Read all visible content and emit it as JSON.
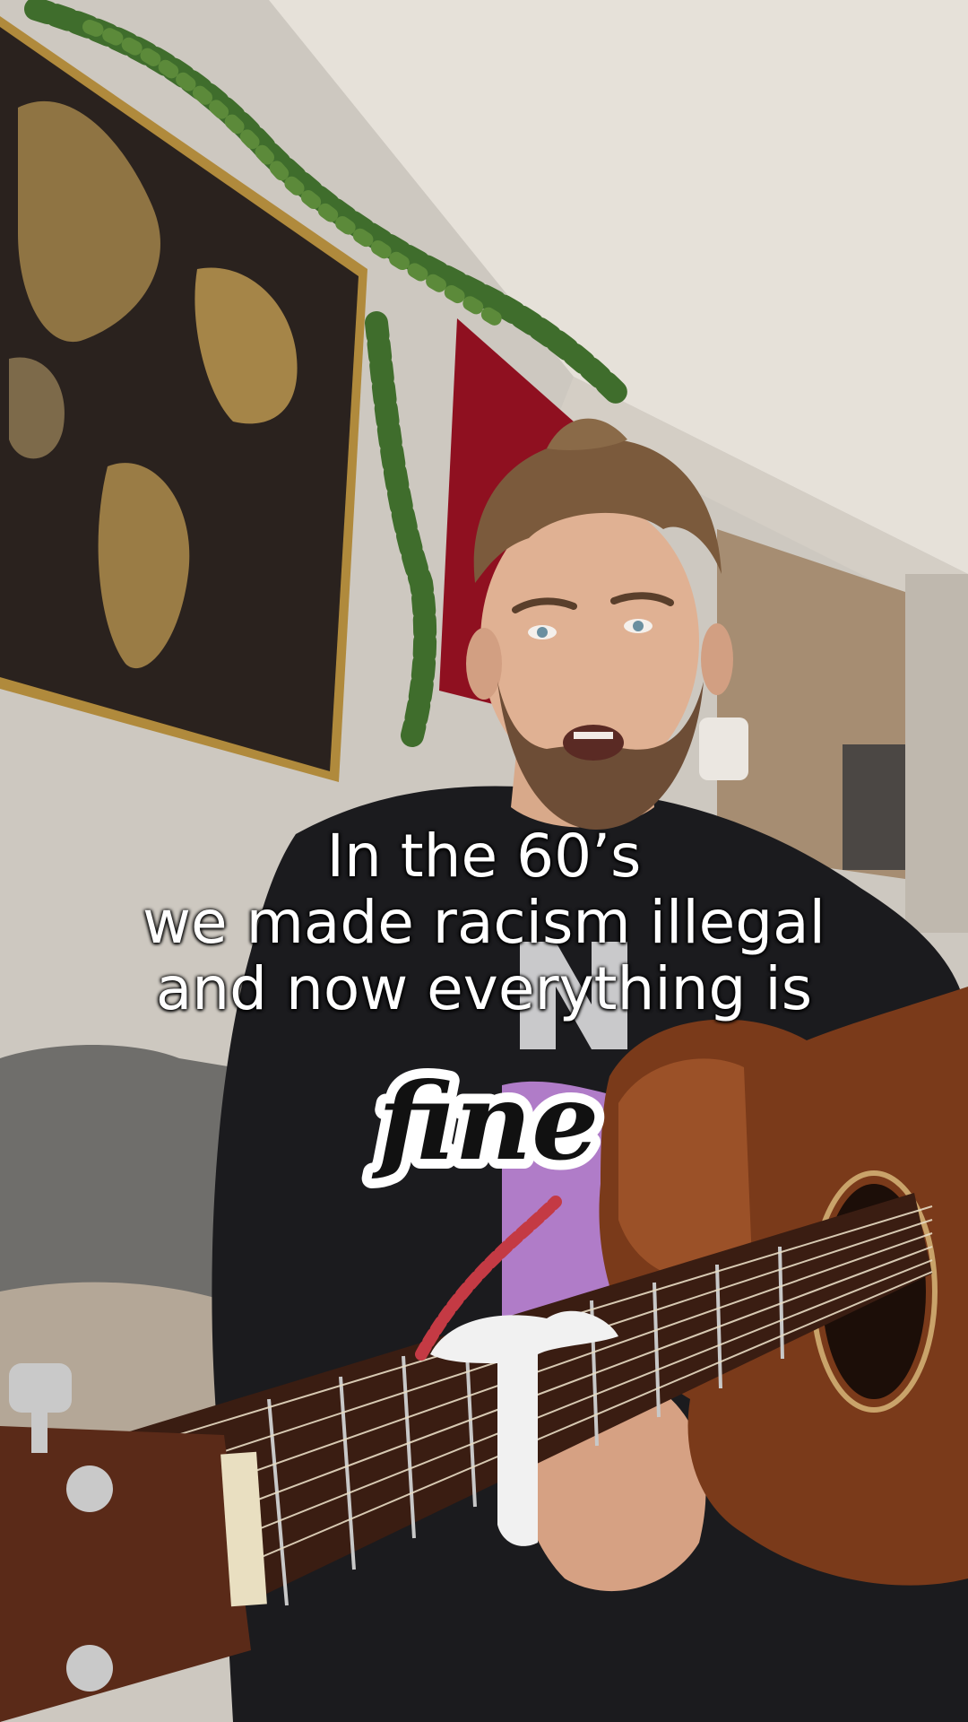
{
  "caption": {
    "lines": [
      "In the 60’s",
      "we made racism illegal",
      "and now everything is"
    ]
  },
  "sticker": {
    "text": "fine",
    "fill_color": "#111111",
    "outline_color": "#ffffff"
  },
  "colors": {
    "wall": "#cfcac3",
    "ceiling": "#e3ded6",
    "map_frame": "#b08a3c",
    "map_dark": "#2a221e",
    "map_gold": "#a58548",
    "red_panel": "#8f1020",
    "ivy": "#3f6d2c",
    "hoodie": "#1b1b1e",
    "couch": "#6f6e6b",
    "guitar_body": "#7a3a1a",
    "guitar_neck": "#3a1d12",
    "capo": "#f1f1f1"
  }
}
